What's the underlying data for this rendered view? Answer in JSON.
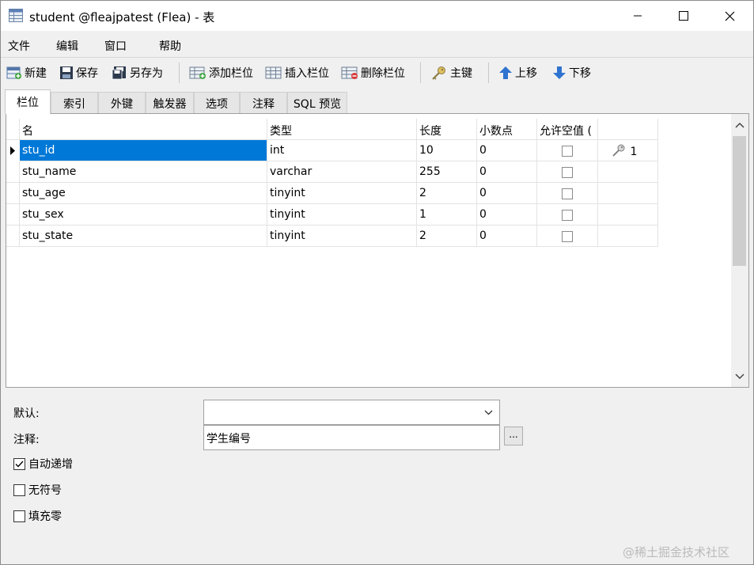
{
  "window": {
    "title": "student @fleajpatest (Flea) - 表"
  },
  "menu": [
    "文件",
    "编辑",
    "窗口",
    "帮助"
  ],
  "toolbar": {
    "new": "新建",
    "save": "保存",
    "save_as": "另存为",
    "add_column": "添加栏位",
    "insert_column": "插入栏位",
    "delete_column": "删除栏位",
    "primary_key": "主键",
    "move_up": "上移",
    "move_down": "下移"
  },
  "tabs": [
    "栏位",
    "索引",
    "外键",
    "触发器",
    "选项",
    "注释",
    "SQL 预览"
  ],
  "grid": {
    "headers": [
      "名",
      "类型",
      "长度",
      "小数点",
      "允许空值 ("
    ],
    "rows": [
      {
        "name": "stu_id",
        "type": "int",
        "length": "10",
        "decimals": "0",
        "nullable": false,
        "key": "1",
        "selected": true
      },
      {
        "name": "stu_name",
        "type": "varchar",
        "length": "255",
        "decimals": "0",
        "nullable": false,
        "key": ""
      },
      {
        "name": "stu_age",
        "type": "tinyint",
        "length": "2",
        "decimals": "0",
        "nullable": false,
        "key": ""
      },
      {
        "name": "stu_sex",
        "type": "tinyint",
        "length": "1",
        "decimals": "0",
        "nullable": false,
        "key": ""
      },
      {
        "name": "stu_state",
        "type": "tinyint",
        "length": "2",
        "decimals": "0",
        "nullable": false,
        "key": ""
      }
    ]
  },
  "properties": {
    "default_label": "默认:",
    "default_value": "",
    "comment_label": "注释:",
    "comment_value": "学生编号",
    "ellipsis": "...",
    "auto_increment_label": "自动递增",
    "auto_increment": true,
    "unsigned_label": "无符号",
    "unsigned": false,
    "zerofill_label": "填充零",
    "zerofill": false
  },
  "watermark": "@稀土掘金技术社区"
}
